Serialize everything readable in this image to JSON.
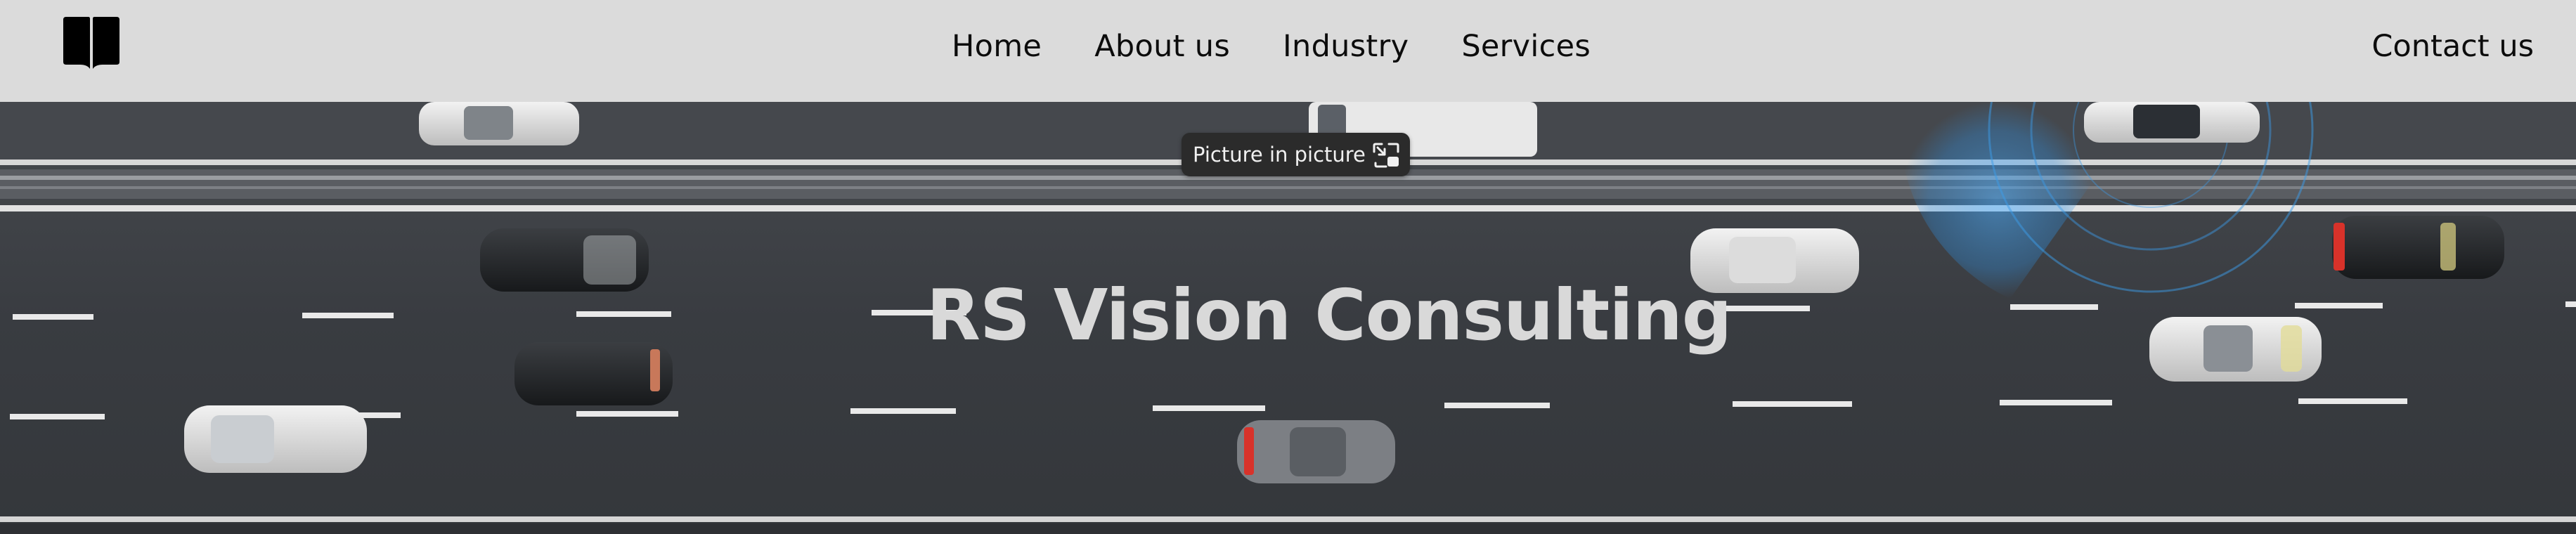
{
  "header": {
    "logo_icon": "open-book-icon",
    "nav": [
      {
        "label": "Home"
      },
      {
        "label": "About us"
      },
      {
        "label": "Industry"
      },
      {
        "label": "Services"
      }
    ],
    "contact_label": "Contact us"
  },
  "hero": {
    "title": "RS Vision Consulting",
    "background": "aerial-highway-video"
  },
  "pip_overlay": {
    "label": "Picture in picture",
    "icon": "picture-in-picture-icon"
  },
  "colors": {
    "navbar_bg": "#dbdbdb",
    "road": "#3a3d42",
    "hero_title": "#d9d9d9",
    "radar_blue": "#2f8fe0"
  }
}
